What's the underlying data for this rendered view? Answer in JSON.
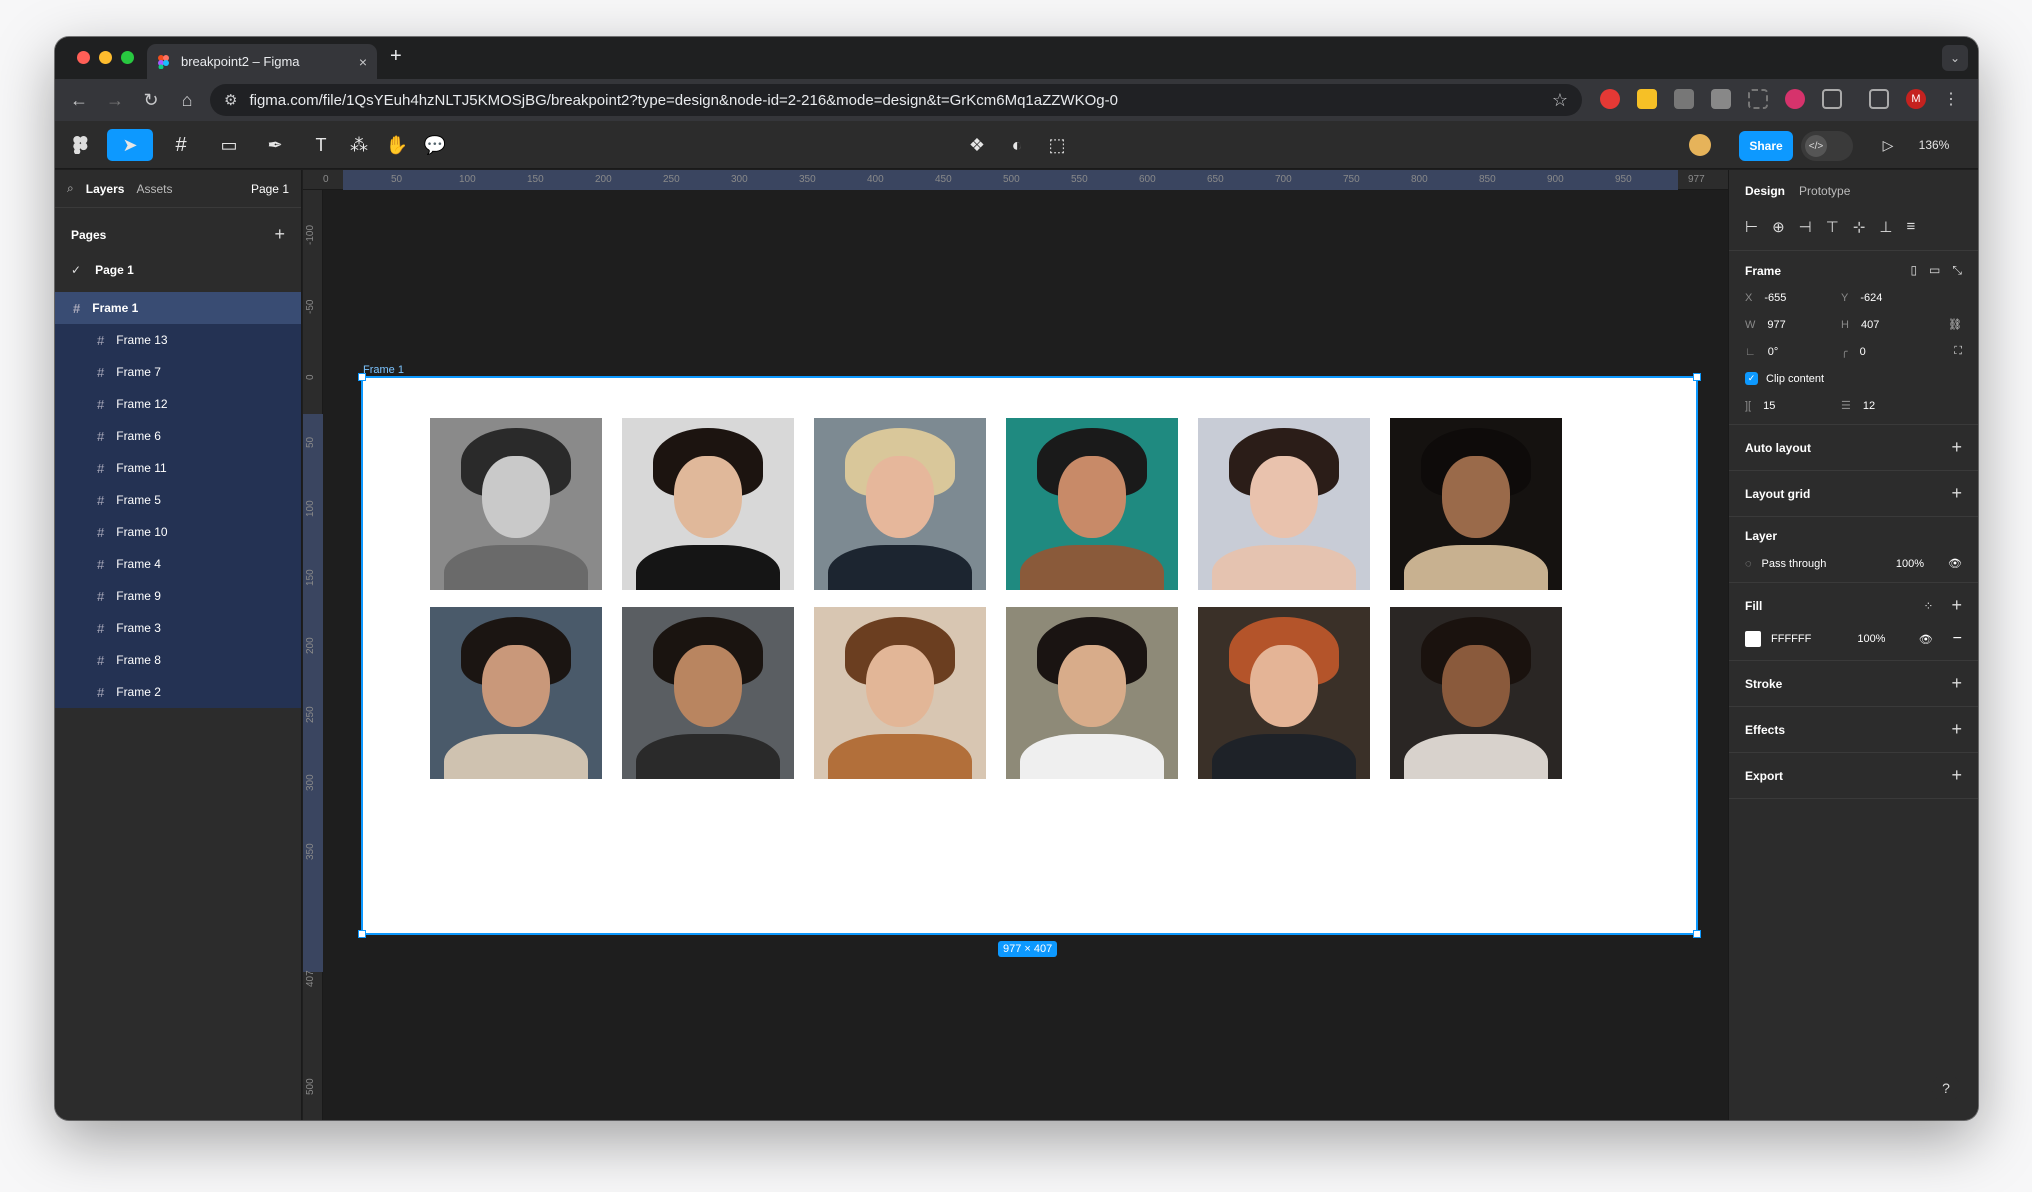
{
  "browser": {
    "tab_title": "breakpoint2 – Figma",
    "tab_close": "×",
    "new_tab": "+",
    "url": "figma.com/file/1QsYEuh4hzNLTJ5KMOSjBG/breakpoint2?type=design&node-id=2-216&mode=design&t=GrKcm6Mq1aZZWKOg-0",
    "profile_initial": "M"
  },
  "toolbar": {
    "share_label": "Share",
    "zoom": "136%"
  },
  "left_panel": {
    "tabs": {
      "layers": "Layers",
      "assets": "Assets"
    },
    "current_page": "Page 1",
    "pages_heading": "Pages",
    "pages": [
      "Page 1"
    ],
    "layers": {
      "root": "Frame 1",
      "children": [
        "Frame 13",
        "Frame 7",
        "Frame 12",
        "Frame 6",
        "Frame 11",
        "Frame 5",
        "Frame 10",
        "Frame 4",
        "Frame 9",
        "Frame 3",
        "Frame 8",
        "Frame 2"
      ]
    }
  },
  "rulers": {
    "top_ticks": [
      "0",
      "50",
      "100",
      "150",
      "200",
      "250",
      "300",
      "350",
      "400",
      "450",
      "500",
      "550",
      "600",
      "650",
      "700",
      "750",
      "800",
      "850",
      "900",
      "950",
      "977"
    ],
    "left_ticks": [
      "-100",
      "-50",
      "0",
      "50",
      "100",
      "150",
      "200",
      "250",
      "300",
      "350",
      "407",
      "500"
    ]
  },
  "canvas": {
    "frame_label": "Frame 1",
    "dimensions": "977 × 407",
    "photos": [
      {
        "bg": "#8a8a8a",
        "hair": "#2a2a2a",
        "skin": "#c9c9c9",
        "body": "#6a6a6a"
      },
      {
        "bg": "#d8d8d8",
        "hair": "#1c1410",
        "skin": "#e0b89a",
        "body": "#151515"
      },
      {
        "bg": "#7d8a92",
        "hair": "#d9c79a",
        "skin": "#e6b79b",
        "body": "#1c2530"
      },
      {
        "bg": "#1f8a80",
        "hair": "#1a1a1a",
        "skin": "#c88a68",
        "body": "#8a5a3a"
      },
      {
        "bg": "#c8ccd6",
        "hair": "#2b1d18",
        "skin": "#e9c2ad",
        "body": "#e5c3b0"
      },
      {
        "bg": "#151210",
        "hair": "#0e0b0a",
        "skin": "#9a6a4a",
        "body": "#c8b190"
      },
      {
        "bg": "#4a5a6a",
        "hair": "#1b1512",
        "skin": "#c9987a",
        "body": "#cfc2b0"
      },
      {
        "bg": "#5a5e62",
        "hair": "#1a1410",
        "skin": "#b98560",
        "body": "#2a2a2a"
      },
      {
        "bg": "#d8c6b2",
        "hair": "#6b3e20",
        "skin": "#e2b697",
        "body": "#b26f3a"
      },
      {
        "bg": "#8e8a78",
        "hair": "#1a1412",
        "skin": "#d8ac8a",
        "body": "#efefef"
      },
      {
        "bg": "#3a3028",
        "hair": "#b4542a",
        "skin": "#e4b496",
        "body": "#1e2228"
      },
      {
        "bg": "#2a2624",
        "hair": "#1a120e",
        "skin": "#8a5a3c",
        "body": "#d8d2cc"
      }
    ]
  },
  "right_panel": {
    "tabs": {
      "design": "Design",
      "prototype": "Prototype"
    },
    "frame_heading": "Frame",
    "x_label": "X",
    "x": "-655",
    "y_label": "Y",
    "y": "-624",
    "w_label": "W",
    "w": "977",
    "h_label": "H",
    "h": "407",
    "rotation": "0°",
    "radius": "0",
    "clip_content": "Clip content",
    "gap_h": "15",
    "gap_v": "12",
    "auto_layout": "Auto layout",
    "layout_grid": "Layout grid",
    "layer_heading": "Layer",
    "blend": "Pass through",
    "layer_opacity": "100%",
    "fill_heading": "Fill",
    "fill_hex": "FFFFFF",
    "fill_opacity": "100%",
    "stroke": "Stroke",
    "effects": "Effects",
    "export": "Export"
  },
  "help": "?"
}
